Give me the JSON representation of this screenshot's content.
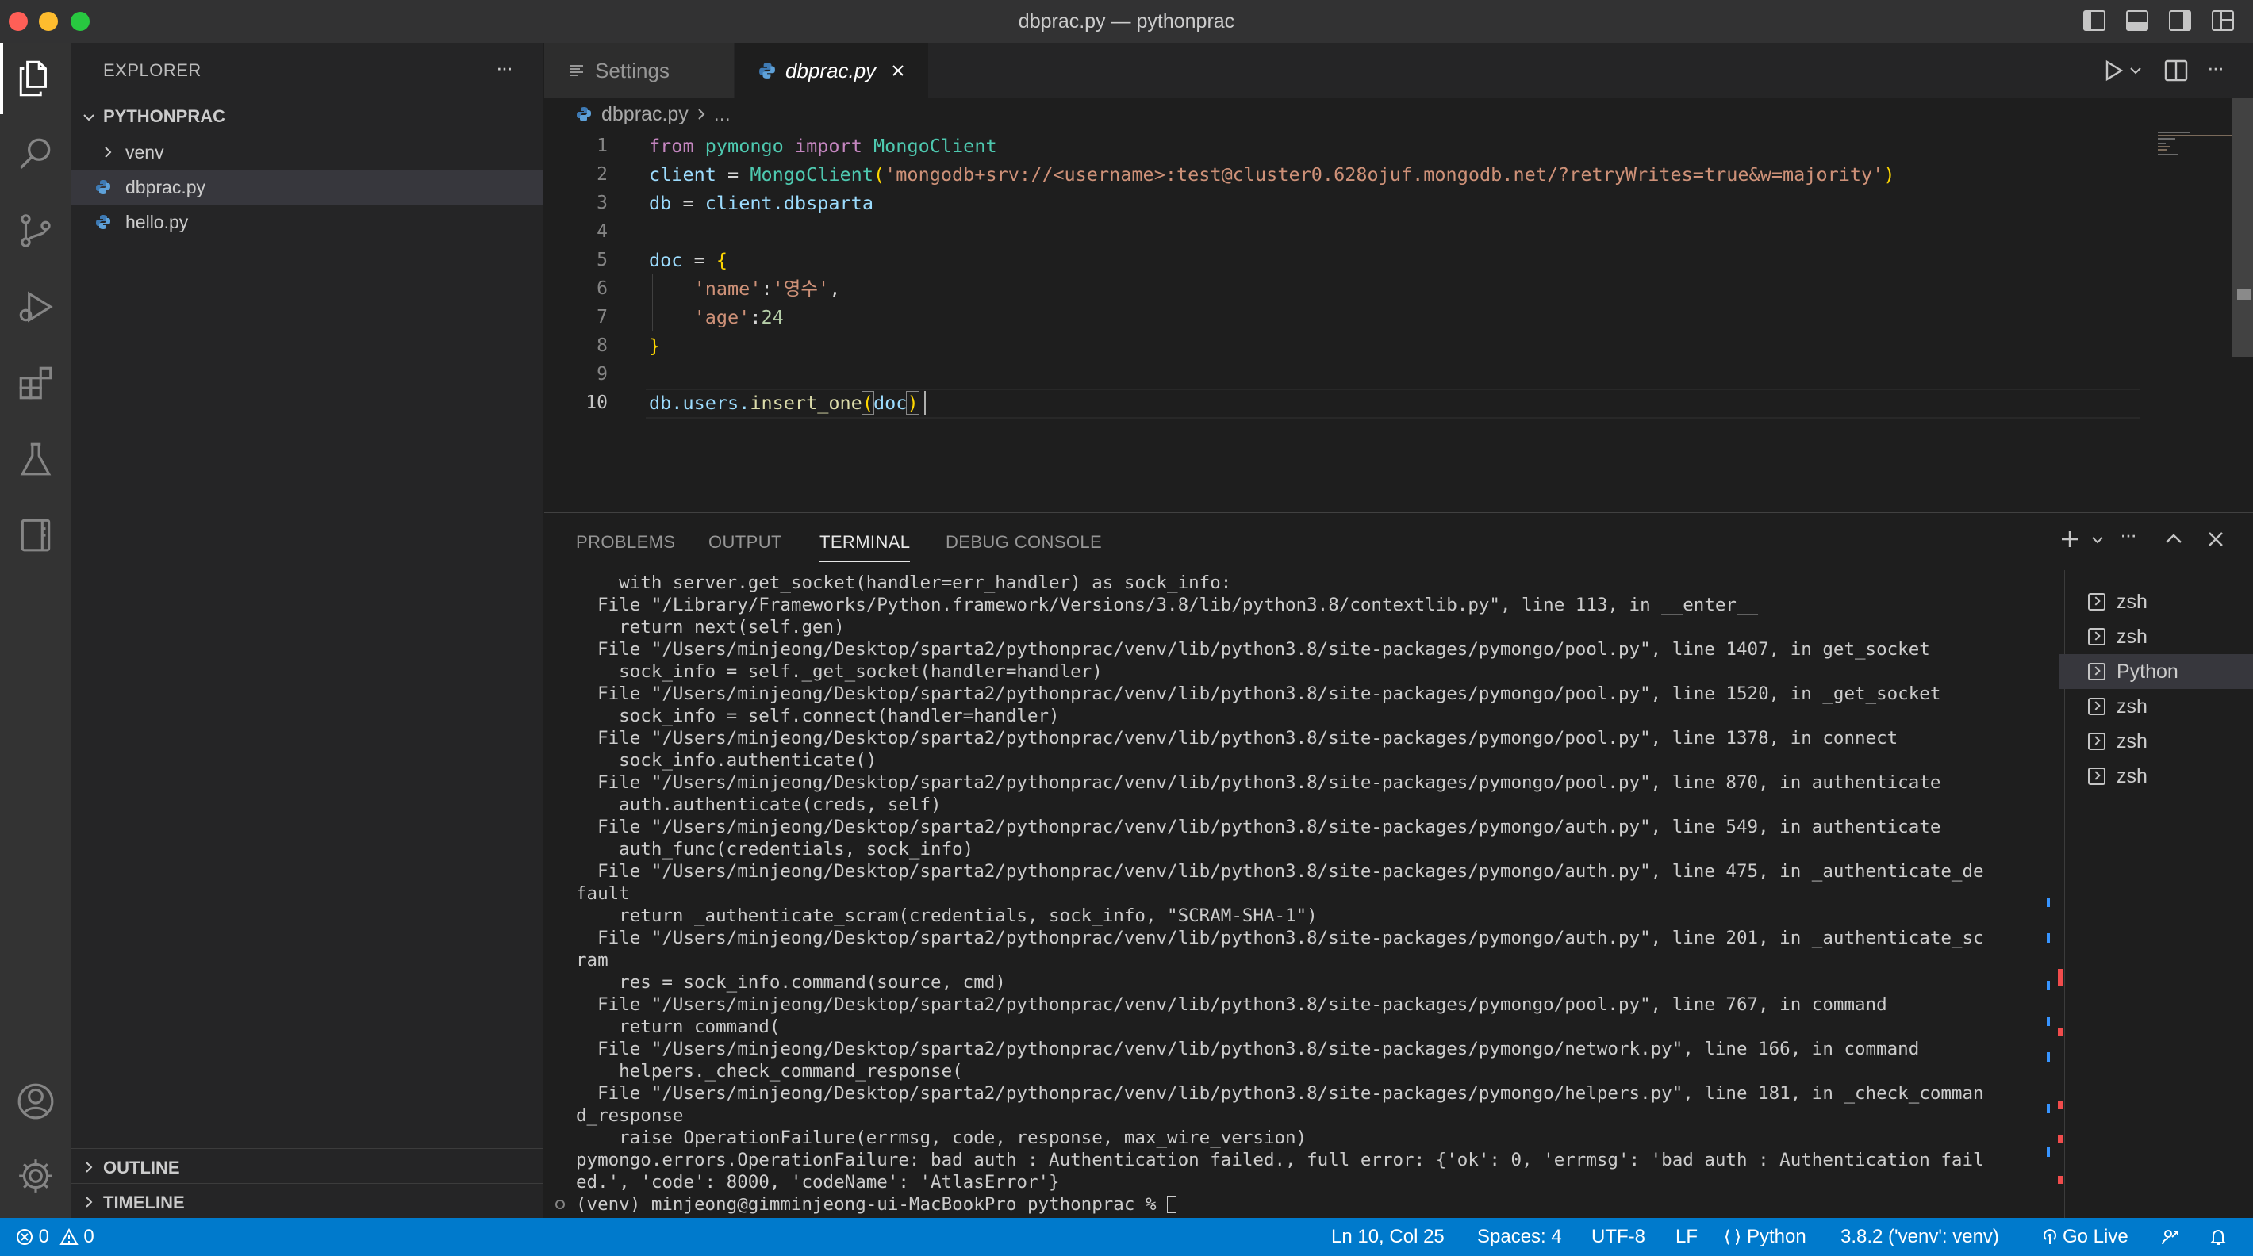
{
  "window": {
    "title": "dbprac.py — pythonprac"
  },
  "sidebar": {
    "title": "EXPLORER",
    "more_label": "···",
    "folder": "PYTHONPRAC",
    "items": [
      {
        "label": "venv",
        "type": "folder"
      },
      {
        "label": "dbprac.py",
        "type": "python-file",
        "selected": true
      },
      {
        "label": "hello.py",
        "type": "python-file"
      }
    ],
    "outline": "OUTLINE",
    "timeline": "TIMELINE"
  },
  "tabs": [
    {
      "label": "Settings",
      "active": false
    },
    {
      "label": "dbprac.py",
      "active": true
    }
  ],
  "breadcrumb": {
    "file": "dbprac.py",
    "more": "..."
  },
  "editor": {
    "lines": [
      {
        "n": "1"
      },
      {
        "n": "2"
      },
      {
        "n": "3"
      },
      {
        "n": "4"
      },
      {
        "n": "5"
      },
      {
        "n": "6"
      },
      {
        "n": "7"
      },
      {
        "n": "8"
      },
      {
        "n": "9"
      },
      {
        "n": "10"
      }
    ],
    "code": {
      "l1_from": "from",
      "l1_mod": "pymongo",
      "l1_import": "import",
      "l1_cls": "MongoClient",
      "l2_var": "client",
      "l2_eq": " = ",
      "l2_cls": "MongoClient",
      "l2_open": "(",
      "l2_str": "'mongodb+srv://<username>:test@cluster0.628ojuf.mongodb.net/?retryWrites=true&w=majority'",
      "l2_close": ")",
      "l3_var": "db",
      "l3_eq": " = ",
      "l3_obj": "client",
      "l3_attr": ".dbsparta",
      "l5_var": "doc",
      "l5_eq": " = ",
      "l5_open": "{",
      "l6_key": "'name'",
      "l6_colon": ":",
      "l6_val": "'영수'",
      "l6_comma": ",",
      "l7_key": "'age'",
      "l7_colon": ":",
      "l7_val": "24",
      "l8_close": "}",
      "l10_obj": "db",
      "l10_attr": ".users.",
      "l10_fn": "insert_one",
      "l10_open": "(",
      "l10_arg": "doc",
      "l10_close": ")"
    }
  },
  "panel": {
    "tabs": [
      "PROBLEMS",
      "OUTPUT",
      "TERMINAL",
      "DEBUG CONSOLE"
    ],
    "active_tab": "TERMINAL",
    "terminal_lines": [
      "    with server.get_socket(handler=err_handler) as sock_info:",
      "  File \"/Library/Frameworks/Python.framework/Versions/3.8/lib/python3.8/contextlib.py\", line 113, in __enter__",
      "    return next(self.gen)",
      "  File \"/Users/minjeong/Desktop/sparta2/pythonprac/venv/lib/python3.8/site-packages/pymongo/pool.py\", line 1407, in get_socket",
      "    sock_info = self._get_socket(handler=handler)",
      "  File \"/Users/minjeong/Desktop/sparta2/pythonprac/venv/lib/python3.8/site-packages/pymongo/pool.py\", line 1520, in _get_socket",
      "    sock_info = self.connect(handler=handler)",
      "  File \"/Users/minjeong/Desktop/sparta2/pythonprac/venv/lib/python3.8/site-packages/pymongo/pool.py\", line 1378, in connect",
      "    sock_info.authenticate()",
      "  File \"/Users/minjeong/Desktop/sparta2/pythonprac/venv/lib/python3.8/site-packages/pymongo/pool.py\", line 870, in authenticate",
      "    auth.authenticate(creds, self)",
      "  File \"/Users/minjeong/Desktop/sparta2/pythonprac/venv/lib/python3.8/site-packages/pymongo/auth.py\", line 549, in authenticate",
      "    auth_func(credentials, sock_info)",
      "  File \"/Users/minjeong/Desktop/sparta2/pythonprac/venv/lib/python3.8/site-packages/pymongo/auth.py\", line 475, in _authenticate_de",
      "fault",
      "    return _authenticate_scram(credentials, sock_info, \"SCRAM-SHA-1\")",
      "  File \"/Users/minjeong/Desktop/sparta2/pythonprac/venv/lib/python3.8/site-packages/pymongo/auth.py\", line 201, in _authenticate_sc",
      "ram",
      "    res = sock_info.command(source, cmd)",
      "  File \"/Users/minjeong/Desktop/sparta2/pythonprac/venv/lib/python3.8/site-packages/pymongo/pool.py\", line 767, in command",
      "    return command(",
      "  File \"/Users/minjeong/Desktop/sparta2/pythonprac/venv/lib/python3.8/site-packages/pymongo/network.py\", line 166, in command",
      "    helpers._check_command_response(",
      "  File \"/Users/minjeong/Desktop/sparta2/pythonprac/venv/lib/python3.8/site-packages/pymongo/helpers.py\", line 181, in _check_comman",
      "d_response",
      "    raise OperationFailure(errmsg, code, response, max_wire_version)",
      "pymongo.errors.OperationFailure: bad auth : Authentication failed., full error: {'ok': 0, 'errmsg': 'bad auth : Authentication fail",
      "ed.', 'code': 8000, 'codeName': 'AtlasError'}"
    ],
    "prompt": "(venv) minjeong@gimminjeong-ui-MacBookPro pythonprac % ",
    "terminals": [
      {
        "label": "zsh",
        "active": false
      },
      {
        "label": "zsh",
        "active": false
      },
      {
        "label": "Python",
        "active": true
      },
      {
        "label": "zsh",
        "active": false
      },
      {
        "label": "zsh",
        "active": false
      },
      {
        "label": "zsh",
        "active": false
      }
    ]
  },
  "statusbar": {
    "errors": "0",
    "warnings": "0",
    "position": "Ln 10, Col 25",
    "spaces": "Spaces: 4",
    "encoding": "UTF-8",
    "eol": "LF",
    "language": "Python",
    "interpreter": "3.8.2 ('venv': venv)",
    "golive": "Go Live"
  },
  "colors": {
    "accent": "#007acc",
    "editor_bg": "#1e1e1e",
    "sidebar_bg": "#252526",
    "activity_bg": "#333333"
  }
}
